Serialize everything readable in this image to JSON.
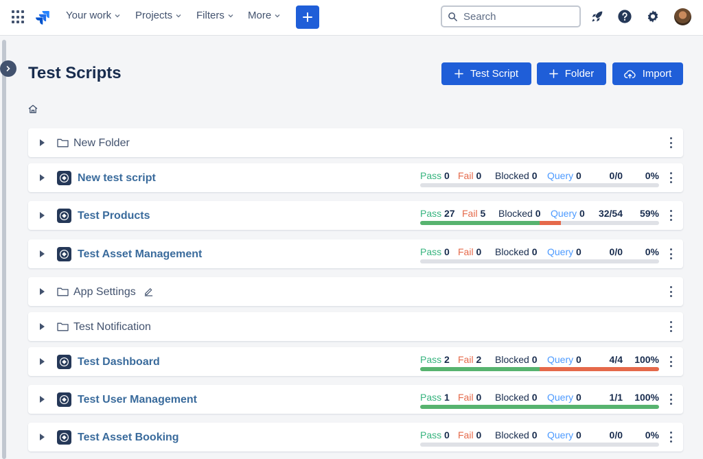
{
  "topbar": {
    "nav": [
      {
        "label": "Your work"
      },
      {
        "label": "Projects"
      },
      {
        "label": "Filters"
      },
      {
        "label": "More"
      }
    ],
    "search_placeholder": "Search",
    "create_icon": "plus-icon",
    "icons": [
      "apps-grid-icon",
      "jira-logo-icon",
      "rocket-icon",
      "help-icon",
      "gear-icon",
      "avatar"
    ]
  },
  "page": {
    "title": "Test Scripts",
    "buttons": {
      "test_script": "Test Script",
      "folder": "Folder",
      "import": "Import"
    }
  },
  "stat_labels": {
    "pass": "Pass",
    "fail": "Fail",
    "blocked": "Blocked",
    "query": "Query"
  },
  "rows": [
    {
      "type": "folder",
      "name": "New Folder"
    },
    {
      "type": "script",
      "name": "New test script",
      "pass": "0",
      "fail": "0",
      "blocked": "0",
      "query": "0",
      "ratio": "0/0",
      "percent": "0%",
      "pass_fraction": 0,
      "fail_fraction": 0
    },
    {
      "type": "script",
      "name": "Test Products",
      "pass": "27",
      "fail": "5",
      "blocked": "0",
      "query": "0",
      "ratio": "32/54",
      "percent": "59%",
      "pass_fraction": 0.5,
      "fail_fraction": 0.09
    },
    {
      "type": "script",
      "name": "Test Asset Management",
      "pass": "0",
      "fail": "0",
      "blocked": "0",
      "query": "0",
      "ratio": "0/0",
      "percent": "0%",
      "pass_fraction": 0,
      "fail_fraction": 0
    },
    {
      "type": "folder",
      "name": "App Settings",
      "editable": true
    },
    {
      "type": "folder",
      "name": "Test Notification"
    },
    {
      "type": "script",
      "name": "Test Dashboard",
      "pass": "2",
      "fail": "2",
      "blocked": "0",
      "query": "0",
      "ratio": "4/4",
      "percent": "100%",
      "pass_fraction": 0.5,
      "fail_fraction": 0.5
    },
    {
      "type": "script",
      "name": "Test User Management",
      "pass": "1",
      "fail": "0",
      "blocked": "0",
      "query": "0",
      "ratio": "1/1",
      "percent": "100%",
      "pass_fraction": 1,
      "fail_fraction": 0
    },
    {
      "type": "script",
      "name": "Test Asset Booking",
      "pass": "0",
      "fail": "0",
      "blocked": "0",
      "query": "0",
      "ratio": "0/0",
      "percent": "0%",
      "pass_fraction": 0,
      "fail_fraction": 0
    }
  ],
  "colors": {
    "primary": "#1f5ed8",
    "pass": "#57b36f",
    "fail": "#e5694a",
    "query": "#4c9aff",
    "script_link": "#3a6b9c"
  }
}
